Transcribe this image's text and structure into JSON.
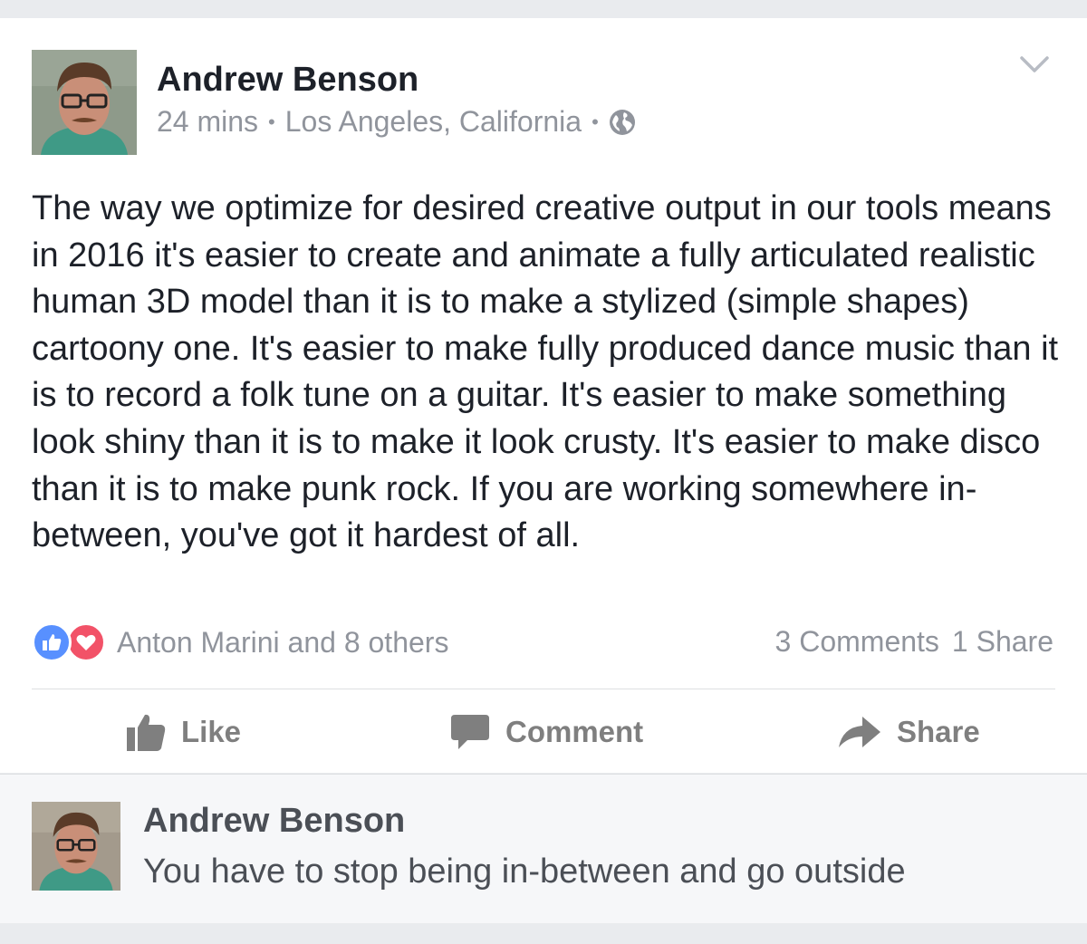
{
  "post": {
    "author": "Andrew Benson",
    "time": "24 mins",
    "separator": "•",
    "location": "Los Angeles, California",
    "privacy_icon": "globe-icon",
    "options_icon": "chevron-down-icon",
    "text": "The way we optimize for desired creative output in our tools means in 2016 it's easier to create and animate a fully articulated realistic human 3D model than it is to make a stylized (simple shapes) cartoony one. It's easier to make fully produced dance music than it is to record a folk tune on a guitar. It's easier to make something look shiny than it is to make it look crusty. It's easier to make disco than it is to make punk rock. If you are working somewhere in-between, you've got it hardest of all."
  },
  "reactions": {
    "icons": [
      "like-reaction-icon",
      "love-reaction-icon"
    ],
    "summary": "Anton Marini and 8 others",
    "comments": "3 Comments",
    "shares": "1 Share"
  },
  "actions": {
    "like": "Like",
    "comment": "Comment",
    "share": "Share"
  },
  "comment": {
    "author": "Andrew Benson",
    "text": "You have to stop being in-between and go outside"
  },
  "colors": {
    "text": "#1d2129",
    "meta": "#90949c",
    "like_blue": "#5890ff",
    "love_red": "#f25268",
    "action_gray": "#7f7f7f",
    "background": "#e9ebee"
  }
}
